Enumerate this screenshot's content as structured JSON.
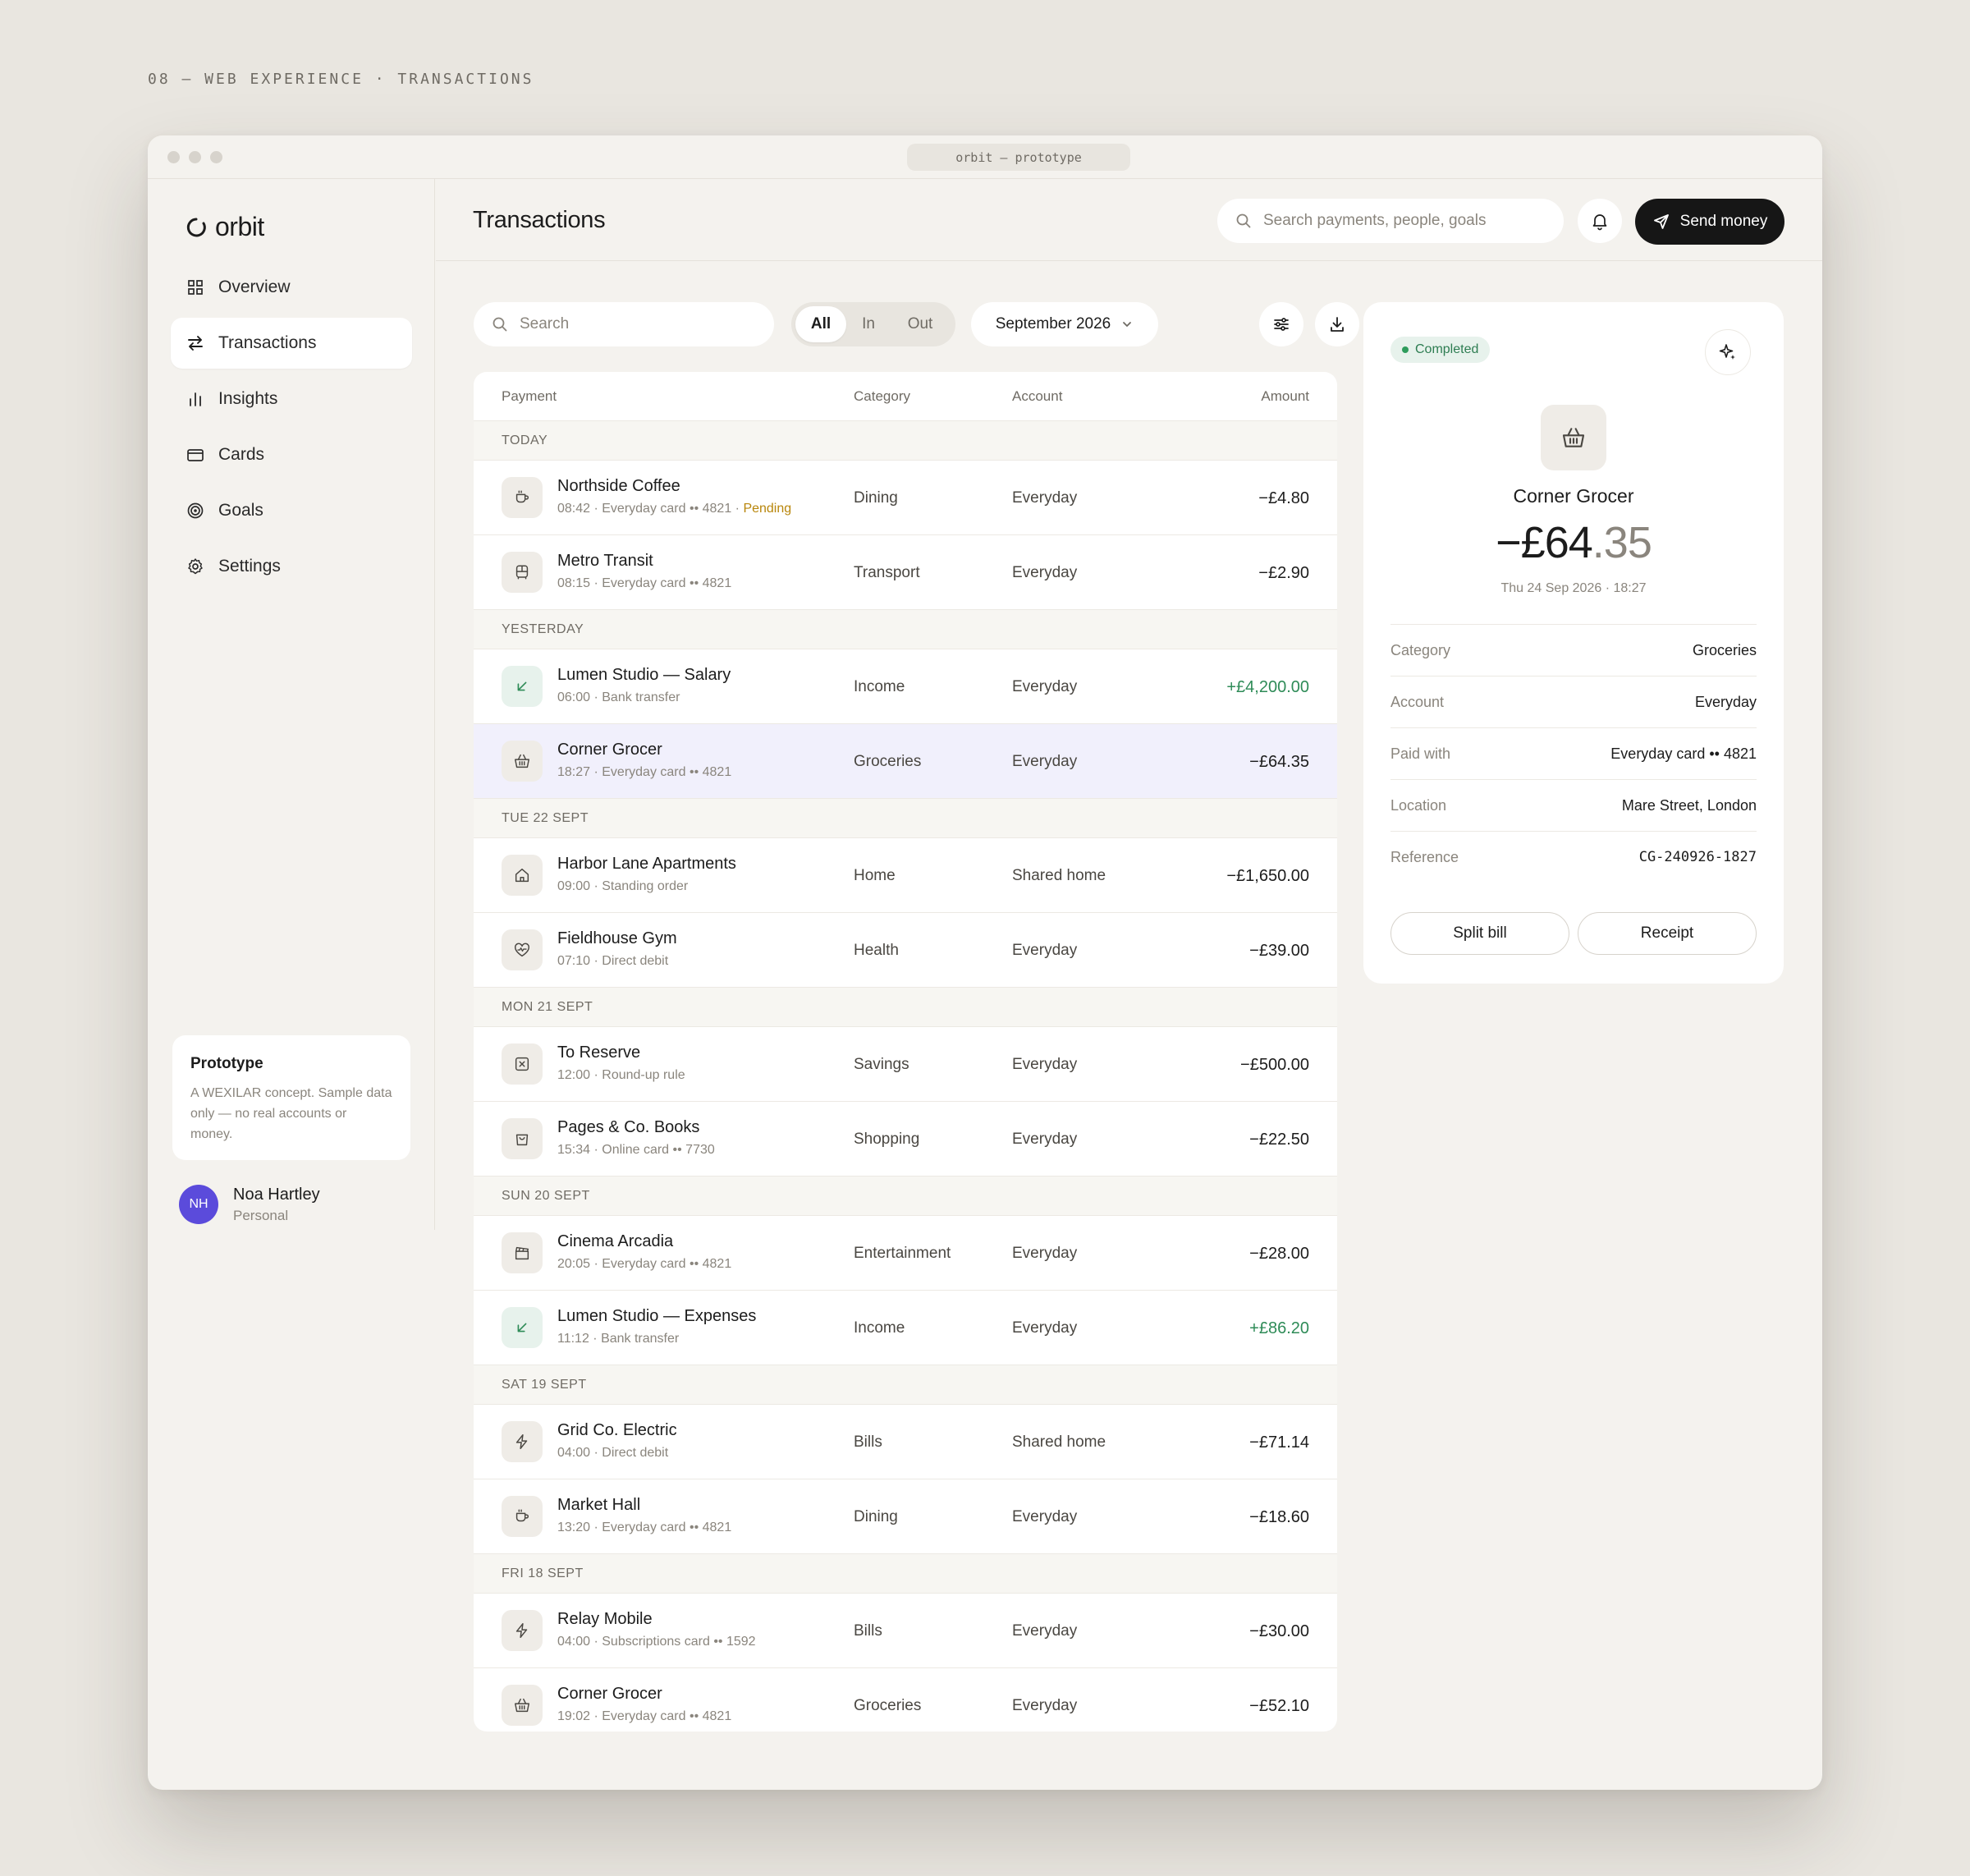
{
  "page_caption": "08 — WEB EXPERIENCE · TRANSACTIONS",
  "window": {
    "url": "orbit — prototype"
  },
  "brand": {
    "name": "orbit"
  },
  "nav": [
    {
      "label": "Overview",
      "icon": "grid-icon",
      "active": false
    },
    {
      "label": "Transactions",
      "icon": "transfer-arrows-icon",
      "active": true
    },
    {
      "label": "Insights",
      "icon": "bar-chart-icon",
      "active": false
    },
    {
      "label": "Cards",
      "icon": "card-icon",
      "active": false
    },
    {
      "label": "Goals",
      "icon": "target-icon",
      "active": false
    },
    {
      "label": "Settings",
      "icon": "gear-icon",
      "active": false
    }
  ],
  "prototype_card": {
    "title": "Prototype",
    "text": "A WEXILAR concept. Sample data only — no real accounts or money."
  },
  "user": {
    "initials": "NH",
    "name": "Noa Hartley",
    "role": "Personal",
    "avatar_color": "#5b4bdb"
  },
  "header": {
    "title": "Transactions",
    "search_placeholder": "Search payments, people, goals",
    "send_label": "Send money"
  },
  "toolbar": {
    "search_placeholder": "Search",
    "filters": [
      "All",
      "In",
      "Out"
    ],
    "active_filter": "All",
    "month": "September 2026"
  },
  "table": {
    "columns": {
      "payment": "Payment",
      "category": "Category",
      "account": "Account",
      "amount": "Amount"
    },
    "groups": [
      {
        "label": "TODAY",
        "rows": [
          {
            "name": "Northside Coffee",
            "meta": "08:42 · Everyday card •• 4821",
            "status": "Pending",
            "category": "Dining",
            "account": "Everyday",
            "amount": "−£4.80",
            "icon": "coffee-cup-icon",
            "income": false
          },
          {
            "name": "Metro Transit",
            "meta": "08:15 · Everyday card •• 4821",
            "category": "Transport",
            "account": "Everyday",
            "amount": "−£2.90",
            "icon": "bus-icon",
            "income": false
          }
        ]
      },
      {
        "label": "YESTERDAY",
        "rows": [
          {
            "name": "Lumen Studio — Salary",
            "meta": "06:00 · Bank transfer",
            "category": "Income",
            "account": "Everyday",
            "amount": "+£4,200.00",
            "icon": "arrow-down-left-icon",
            "income": true
          },
          {
            "name": "Corner Grocer",
            "meta": "18:27 · Everyday card •• 4821",
            "category": "Groceries",
            "account": "Everyday",
            "amount": "−£64.35",
            "icon": "basket-icon",
            "income": false,
            "selected": true
          }
        ]
      },
      {
        "label": "TUE 22 SEPT",
        "rows": [
          {
            "name": "Harbor Lane Apartments",
            "meta": "09:00 · Standing order",
            "category": "Home",
            "account": "Shared home",
            "amount": "−£1,650.00",
            "icon": "house-icon",
            "income": false
          },
          {
            "name": "Fieldhouse Gym",
            "meta": "07:10 · Direct debit",
            "category": "Health",
            "account": "Everyday",
            "amount": "−£39.00",
            "icon": "heart-pulse-icon",
            "income": false
          }
        ]
      },
      {
        "label": "MON 21 SEPT",
        "rows": [
          {
            "name": "To Reserve",
            "meta": "12:00 · Round-up rule",
            "category": "Savings",
            "account": "Everyday",
            "amount": "−£500.00",
            "icon": "vault-icon",
            "income": false
          },
          {
            "name": "Pages & Co. Books",
            "meta": "15:34 · Online card •• 7730",
            "category": "Shopping",
            "account": "Everyday",
            "amount": "−£22.50",
            "icon": "shopping-bag-icon",
            "income": false
          }
        ]
      },
      {
        "label": "SUN 20 SEPT",
        "rows": [
          {
            "name": "Cinema Arcadia",
            "meta": "20:05 · Everyday card •• 4821",
            "category": "Entertainment",
            "account": "Everyday",
            "amount": "−£28.00",
            "icon": "clapperboard-icon",
            "income": false
          },
          {
            "name": "Lumen Studio — Expenses",
            "meta": "11:12 · Bank transfer",
            "category": "Income",
            "account": "Everyday",
            "amount": "+£86.20",
            "icon": "arrow-down-left-icon",
            "income": true
          }
        ]
      },
      {
        "label": "SAT 19 SEPT",
        "rows": [
          {
            "name": "Grid Co. Electric",
            "meta": "04:00 · Direct debit",
            "category": "Bills",
            "account": "Shared home",
            "amount": "−£71.14",
            "icon": "lightning-icon",
            "income": false
          },
          {
            "name": "Market Hall",
            "meta": "13:20 · Everyday card •• 4821",
            "category": "Dining",
            "account": "Everyday",
            "amount": "−£18.60",
            "icon": "coffee-cup-icon",
            "income": false
          }
        ]
      },
      {
        "label": "FRI 18 SEPT",
        "rows": [
          {
            "name": "Relay Mobile",
            "meta": "04:00 · Subscriptions card •• 1592",
            "category": "Bills",
            "account": "Everyday",
            "amount": "−£30.00",
            "icon": "lightning-icon",
            "income": false
          },
          {
            "name": "Corner Grocer",
            "meta": "19:02 · Everyday card •• 4821",
            "category": "Groceries",
            "account": "Everyday",
            "amount": "−£52.10",
            "icon": "basket-icon",
            "income": false
          }
        ]
      }
    ]
  },
  "detail": {
    "status": "Completed",
    "merchant": "Corner Grocer",
    "amount_main": "−£64",
    "amount_pence": ".35",
    "datetime": "Thu 24 Sep 2026 · 18:27",
    "fields": [
      {
        "key": "Category",
        "value": "Groceries"
      },
      {
        "key": "Account",
        "value": "Everyday"
      },
      {
        "key": "Paid with",
        "value": "Everyday card •• 4821"
      },
      {
        "key": "Location",
        "value": "Mare Street, London"
      },
      {
        "key": "Reference",
        "value": "CG-240926-1827"
      }
    ],
    "actions": [
      "Split bill",
      "Receipt"
    ]
  },
  "colors": {
    "accent_dark": "#161616",
    "income": "#2e8b57",
    "pending": "#b8860b",
    "selected_row": "#f1f0fc",
    "completed": "#2e7d52"
  }
}
